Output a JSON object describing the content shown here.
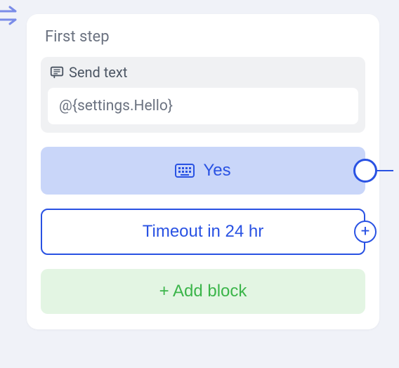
{
  "card": {
    "title": "First step",
    "send_text": {
      "label": "Send text",
      "value": "@{settings.Hello}"
    },
    "yes_button": {
      "label": "Yes"
    },
    "timeout_button": {
      "label": "Timeout in 24 hr"
    },
    "add_block_button": {
      "label": "+ Add block"
    },
    "add_port": {
      "symbol": "+"
    }
  }
}
